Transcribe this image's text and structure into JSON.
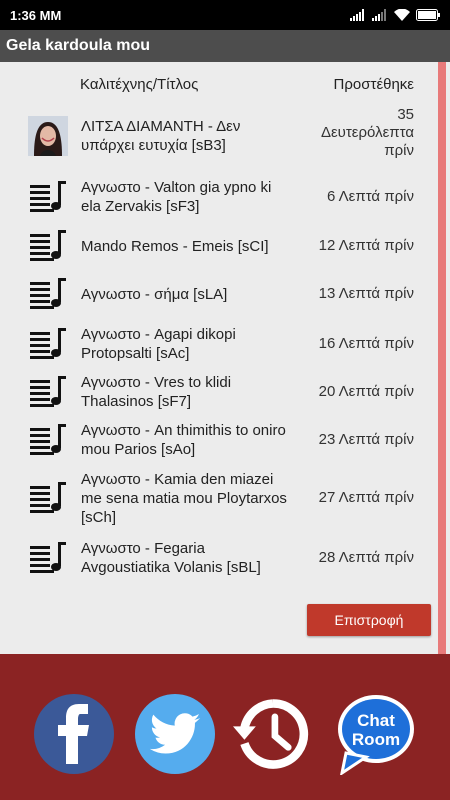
{
  "status": {
    "time": "1:36 MM"
  },
  "app": {
    "title": "Gela kardoula mou"
  },
  "table": {
    "col_artist_title": "Καλιτέχνης/Τίτλος",
    "col_added": "Προστέθηκε",
    "rows": [
      {
        "title": "ΛΙΤΣΑ ΔΙΑΜΑΝΤΗ - Δεν υπάρχει ευτυχία [sB3]",
        "added": "35 Δευτερόλεπτα πρίν",
        "icon": "artist-photo"
      },
      {
        "title": "Αγνωστο - Valton gia ypno ki ela Zervakis [sF3]",
        "added": "6 Λεπτά πρίν",
        "icon": "music-list-icon"
      },
      {
        "title": "Mando Remos - Emeis [sCI]",
        "added": "12 Λεπτά πρίν",
        "icon": "music-list-icon"
      },
      {
        "title": "Αγνωστο - σήμα [sLA]",
        "added": "13 Λεπτά πρίν",
        "icon": "music-list-icon"
      },
      {
        "title": "Αγνωστο - Agapi dikopi Protopsalti [sAc]",
        "added": "16 Λεπτά πρίν",
        "icon": "music-list-icon"
      },
      {
        "title": "Αγνωστο - Vres to klidi Thalasinos [sF7]",
        "added": "20 Λεπτά πρίν",
        "icon": "music-list-icon"
      },
      {
        "title": "Αγνωστο - An thimithis to oniro mou Parios [sAo]",
        "added": "23 Λεπτά πρίν",
        "icon": "music-list-icon"
      },
      {
        "title": "Αγνωστο - Kamia den miazei me sena matia mou Ploytarxos [sCh]",
        "added": "27 Λεπτά πρίν",
        "icon": "music-list-icon"
      },
      {
        "title": "Αγνωστο - Fegaria Avgoustiatika Volanis [sBL]",
        "added": "28 Λεπτά πρίν",
        "icon": "music-list-icon"
      }
    ]
  },
  "back_button": "Επιστροφή",
  "footer": {
    "chat_label_1": "Chat",
    "chat_label_2": "Room",
    "icons": [
      "facebook-icon",
      "twitter-icon",
      "history-icon",
      "chat-room-icon"
    ]
  },
  "colors": {
    "footer_bg": "#8b2323",
    "button_bg": "#c0392b",
    "facebook": "#3b5998",
    "twitter": "#55acee",
    "chat": "#1e6fd9"
  }
}
